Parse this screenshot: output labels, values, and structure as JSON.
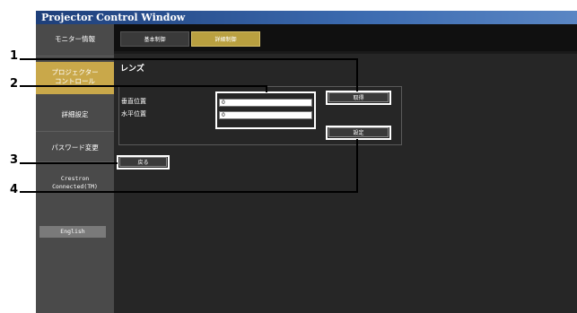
{
  "window": {
    "title": "Projector Control Window"
  },
  "sidebar": {
    "items": [
      {
        "label": "モニター情報"
      },
      {
        "label_line1": "プロジェクター",
        "label_line2": "コントロール"
      },
      {
        "label": "詳細設定"
      },
      {
        "label": "パスワード変更"
      },
      {
        "label_line1": "Crestron",
        "label_line2": "Connected(TM)"
      }
    ],
    "language_button": "English"
  },
  "tabs": [
    {
      "label": "基本制御"
    },
    {
      "label": "詳細制御"
    }
  ],
  "main": {
    "section_title": "レンズ",
    "vertical_position": {
      "label": "垂直位置",
      "value": "0"
    },
    "horizontal_position": {
      "label": "水平位置",
      "value": "0"
    },
    "get_button": "取得",
    "set_button": "設定",
    "back_button": "戻る"
  },
  "callouts": [
    "1",
    "2",
    "3",
    "4"
  ]
}
